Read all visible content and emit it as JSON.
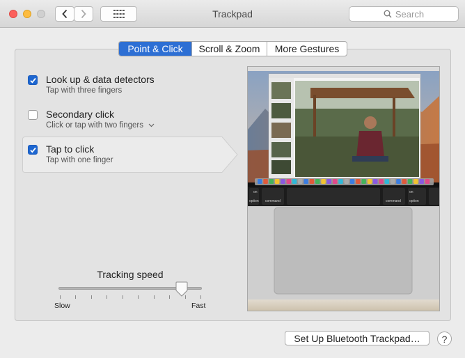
{
  "window": {
    "title": "Trackpad",
    "search_placeholder": "Search"
  },
  "tabs": [
    {
      "label": "Point & Click",
      "active": true
    },
    {
      "label": "Scroll & Zoom",
      "active": false
    },
    {
      "label": "More Gestures",
      "active": false
    }
  ],
  "options": [
    {
      "title": "Look up & data detectors",
      "subtitle": "Tap with three fingers",
      "checked": true
    },
    {
      "title": "Secondary click",
      "subtitle": "Click or tap with two fingers",
      "checked": false,
      "has_dropdown": true
    },
    {
      "title": "Tap to click",
      "subtitle": "Tap with one finger",
      "checked": true,
      "selected": true
    }
  ],
  "tracking": {
    "label": "Tracking speed",
    "min_label": "Slow",
    "max_label": "Fast",
    "value_fraction": 0.86
  },
  "preview": {
    "keys": [
      "on",
      "option",
      "command",
      "command",
      "on",
      "option"
    ]
  },
  "buttons": {
    "bluetooth": "Set Up Bluetooth Trackpad…",
    "help": "?"
  },
  "colors": {
    "accent": "#2d6fd4",
    "close": "#fc605c",
    "minimize": "#fdbc40"
  }
}
